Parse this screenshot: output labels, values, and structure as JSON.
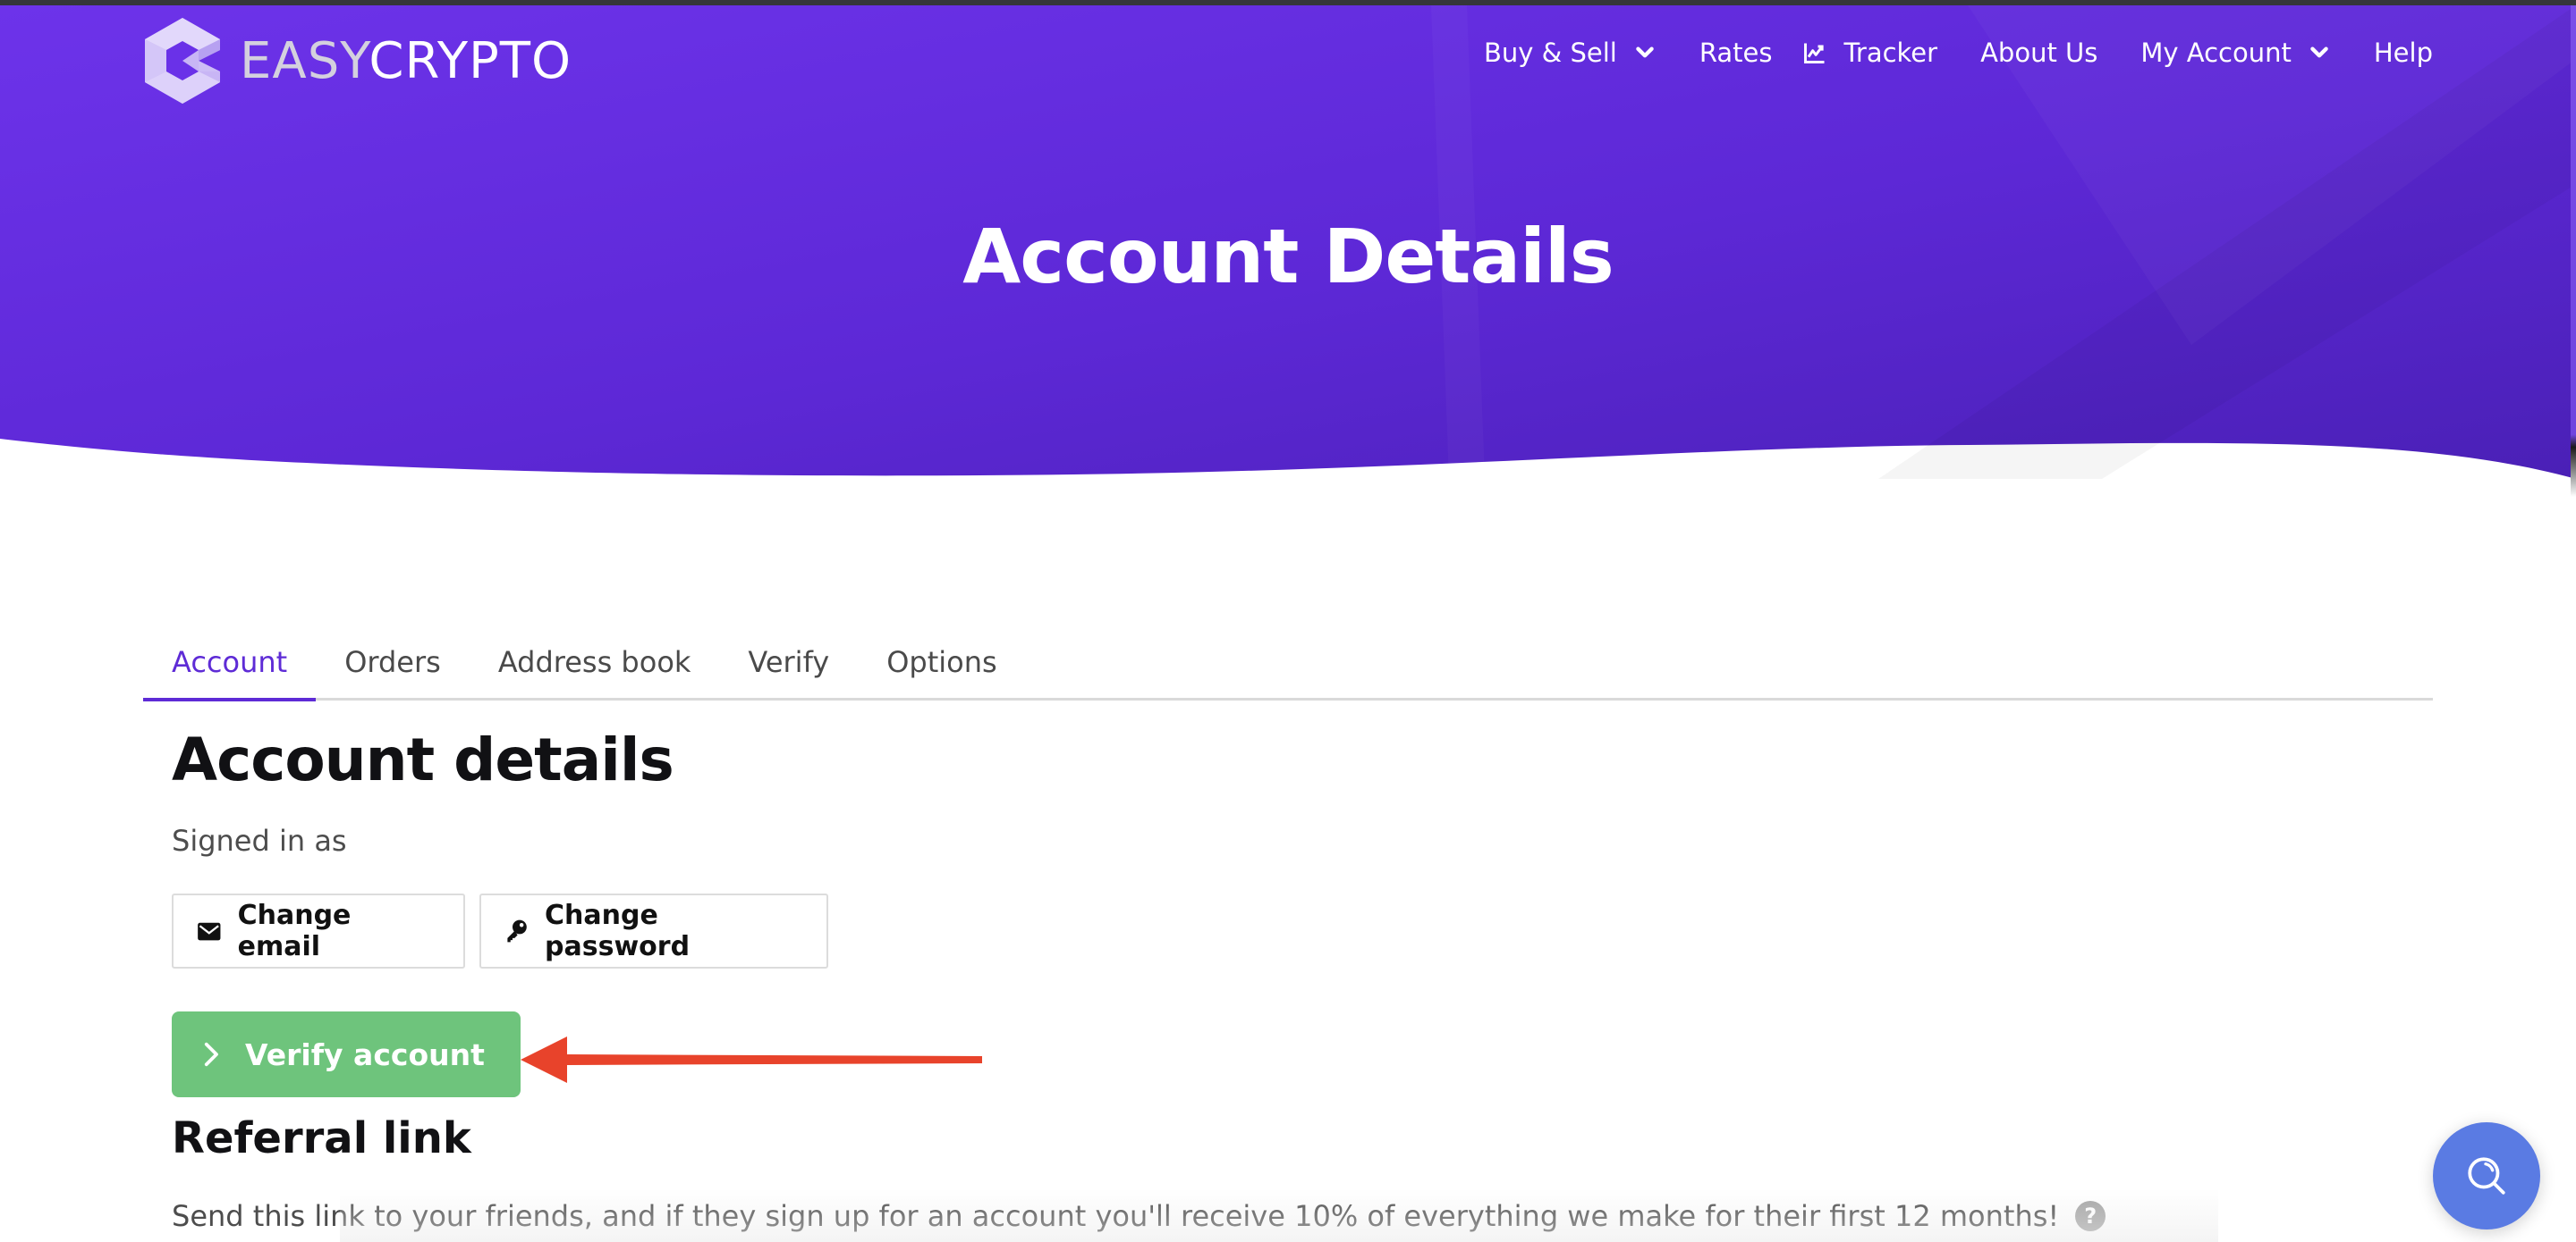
{
  "brand": {
    "name_part1": "EASY",
    "name_part2": "CRYPTO",
    "logo_icon": "easycrypto-hexagon-logo-icon"
  },
  "nav": {
    "items": [
      {
        "label": "Buy & Sell",
        "icon": "chevron-down-icon",
        "has_dropdown": true
      },
      {
        "label": "Rates",
        "has_dropdown": false
      },
      {
        "label": "Tracker",
        "icon": "chart-line-icon",
        "has_dropdown": false
      },
      {
        "label": "About Us",
        "has_dropdown": false
      },
      {
        "label": "My Account",
        "icon": "chevron-down-icon",
        "has_dropdown": true
      },
      {
        "label": "Help",
        "has_dropdown": false
      }
    ]
  },
  "hero": {
    "title": "Account Details"
  },
  "tabs": [
    {
      "label": "Account",
      "active": true
    },
    {
      "label": "Orders",
      "active": false
    },
    {
      "label": "Address book",
      "active": false
    },
    {
      "label": "Verify",
      "active": false
    },
    {
      "label": "Options",
      "active": false
    }
  ],
  "account": {
    "title": "Account details",
    "signed_in_label": "Signed in as",
    "change_email_label": "Change email",
    "change_email_icon": "envelope-icon",
    "change_password_label": "Change password",
    "change_password_icon": "key-icon",
    "verify_label": "Verify account",
    "verify_icon": "chevron-right-icon"
  },
  "annotation": {
    "type": "arrow",
    "color": "#e8432b",
    "points_to": "Verify account"
  },
  "referral": {
    "title": "Referral link",
    "description": "Send this link to your friends, and if they sign up for an account you'll receive 10% of everything we make for their first 12 months!",
    "help_icon": "question-circle-icon"
  },
  "search_fab": {
    "icon": "search-icon"
  },
  "colors": {
    "brand_purple": "#6a31e8",
    "active_tab": "#5e2bd6",
    "verify_green": "#6ec47c",
    "search_blue": "#5a7be3",
    "annotation_red": "#e8432b"
  }
}
